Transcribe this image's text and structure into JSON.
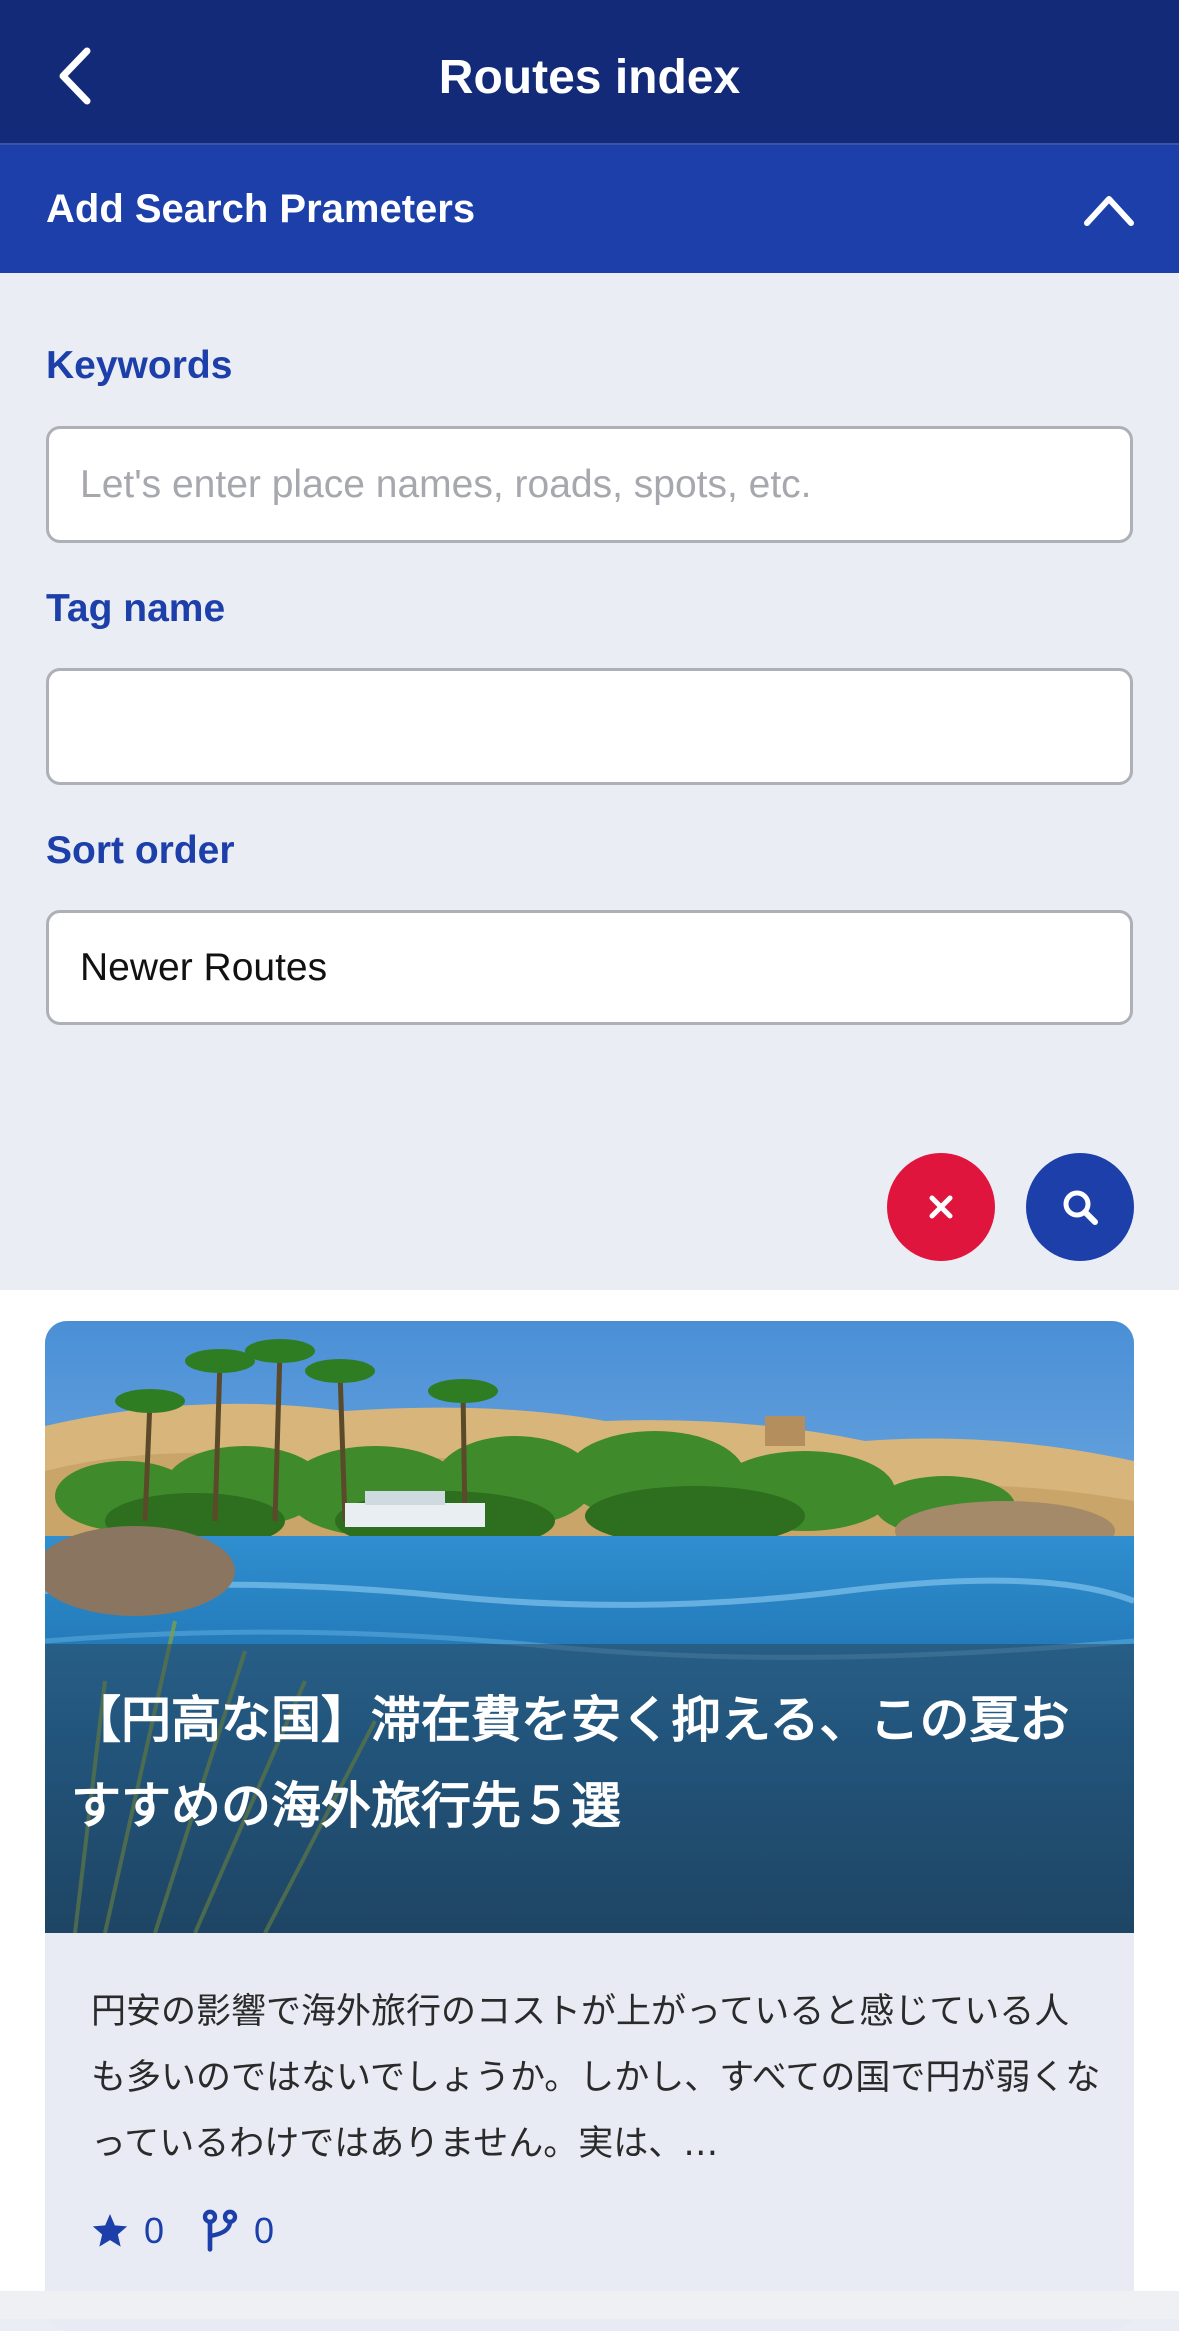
{
  "header": {
    "title": "Routes index",
    "back_icon": "chevron-left-icon"
  },
  "search_params": {
    "title": "Add Search Prameters",
    "toggle_icon": "chevron-up-icon",
    "expanded": true
  },
  "form": {
    "keywords": {
      "label": "Keywords",
      "value": "",
      "placeholder": "Let's enter place names, roads, spots, etc."
    },
    "tag_name": {
      "label": "Tag name",
      "value": "",
      "placeholder": ""
    },
    "sort_order": {
      "label": "Sort order",
      "value": "Newer Routes"
    },
    "clear_button": {
      "icon": "close-icon",
      "color": "#e0153d"
    },
    "search_button": {
      "icon": "search-icon",
      "color": "#1c3faa"
    }
  },
  "routes": [
    {
      "image": "nile-river-palm-trees-landscape",
      "title": "【円高な国】滞在費を安く抑える、この夏おすすめの海外旅行先５選",
      "excerpt": "円安の影響で海外旅行のコストが上がっていると感じている人も多いのではないでしょうか。しかし、すべての国で円が弱くなっているわけではありません。実は、…",
      "stars": "0",
      "forks": "0",
      "star_icon": "star-icon",
      "fork_icon": "fork-icon"
    }
  ],
  "colors": {
    "header_bg": "#132a78",
    "accent": "#1c3faa",
    "danger": "#e0153d",
    "form_bg": "#ebedf4"
  }
}
